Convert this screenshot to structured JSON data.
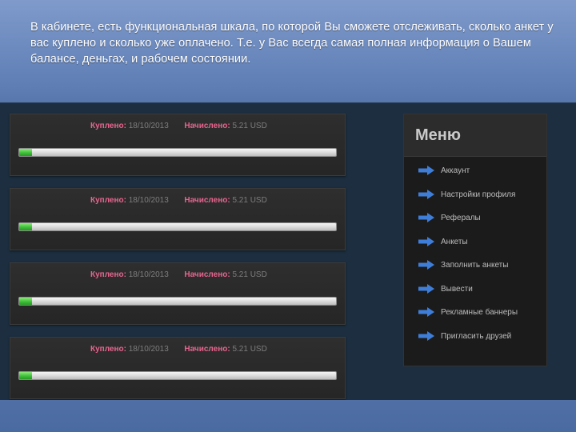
{
  "intro": {
    "text": "В кабинете, есть функциональная шкала, по которой Вы сможете отслеживать, сколько анкет у вас куплено и сколько уже оплачено. Т.е. у Вас всегда самая полная информация о Вашем балансе, деньгах, и рабочем состоянии."
  },
  "cards": [
    {
      "bought_label": "Куплено:",
      "bought_value": "18/10/2013",
      "charged_label": "Начислено:",
      "charged_value": "5.21 USD",
      "progress": 0.04
    },
    {
      "bought_label": "Куплено:",
      "bought_value": "18/10/2013",
      "charged_label": "Начислено:",
      "charged_value": "5.21 USD",
      "progress": 0.04
    },
    {
      "bought_label": "Куплено:",
      "bought_value": "18/10/2013",
      "charged_label": "Начислено:",
      "charged_value": "5.21 USD",
      "progress": 0.04
    },
    {
      "bought_label": "Куплено:",
      "bought_value": "18/10/2013",
      "charged_label": "Начислено:",
      "charged_value": "5.21 USD",
      "progress": 0.04
    }
  ],
  "menu": {
    "title": "Меню",
    "items": [
      {
        "label": "Аккаунт",
        "icon": "arrow-right-icon"
      },
      {
        "label": "Настройки профиля",
        "icon": "arrow-right-icon"
      },
      {
        "label": "Рефералы",
        "icon": "arrow-right-icon"
      },
      {
        "label": "Анкеты",
        "icon": "arrow-right-icon"
      },
      {
        "label": "Заполнить анкеты",
        "icon": "arrow-right-icon"
      },
      {
        "label": "Вывести",
        "icon": "arrow-right-icon"
      },
      {
        "label": "Рекламные баннеры",
        "icon": "arrow-right-icon"
      },
      {
        "label": "Пригласить друзей",
        "icon": "arrow-right-icon"
      }
    ]
  },
  "colors": {
    "label_pink": "#e7658f",
    "progress_green": "#3fc03a",
    "arrow_blue": "#3f7ed8"
  }
}
